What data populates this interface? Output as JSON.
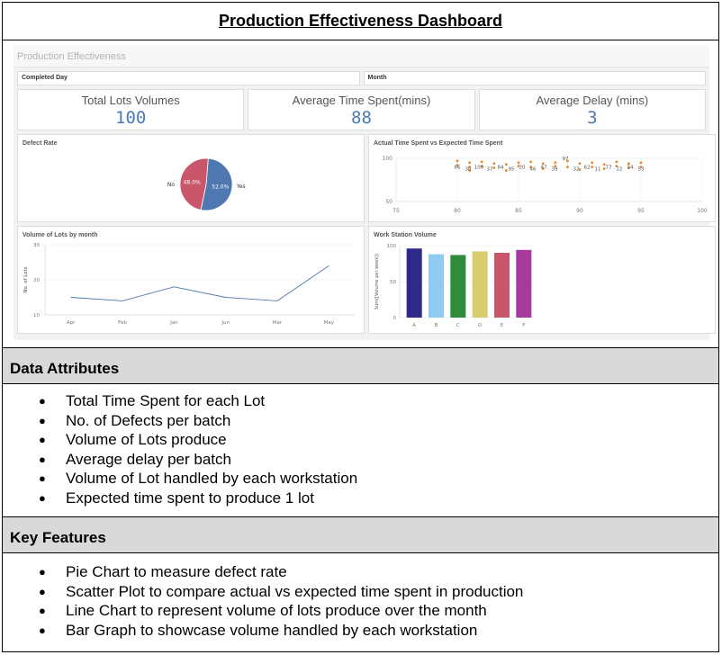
{
  "document": {
    "title": "Production Effectiveness Dashboard"
  },
  "dashboard": {
    "sheet_title": "Production Effectiveness",
    "filters": [
      "Completed Day",
      "Month"
    ],
    "kpis": [
      {
        "label": "Total Lots Volumes",
        "value": "100"
      },
      {
        "label": "Average Time Spent(mins)",
        "value": "88"
      },
      {
        "label": "Average Delay (mins)",
        "value": "3"
      }
    ],
    "panels": {
      "defect_rate": "Defect Rate",
      "scatter": "Actual Time Spent vs Expected Time Spent",
      "line": "Volume of Lots by month",
      "bar": "Work Station Volume"
    }
  },
  "chart_data": [
    {
      "type": "pie",
      "title": "Defect Rate",
      "categories": [
        "No",
        "Yes"
      ],
      "values": [
        48.0,
        52.0
      ],
      "data_labels": [
        "48.0%",
        "52.0%"
      ],
      "colors": [
        "#c9566a",
        "#4f78b0"
      ]
    },
    {
      "type": "scatter",
      "title": "Actual Time Spent vs Expected Time Spent",
      "xlim": [
        75,
        100
      ],
      "ylim": [
        50,
        100
      ],
      "x_ticks": [
        "75",
        "80",
        "85",
        "90",
        "95",
        "100"
      ],
      "y_ticks": [
        "100",
        "50"
      ],
      "x": [
        80,
        80,
        81,
        81,
        81,
        82,
        82,
        83,
        83,
        84,
        84,
        85,
        85,
        86,
        86,
        87,
        87,
        88,
        88,
        89,
        89,
        90,
        90,
        91,
        91,
        92,
        92,
        93,
        93,
        94,
        94,
        95,
        95
      ],
      "y": [
        97,
        92,
        95,
        90,
        86,
        96,
        91,
        94,
        89,
        93,
        86,
        95,
        91,
        96,
        90,
        94,
        88,
        95,
        91,
        97,
        90,
        94,
        87,
        95,
        90,
        93,
        88,
        96,
        91,
        94,
        89,
        95,
        90
      ],
      "point_labels": [
        "66",
        "30",
        "100",
        "37",
        "84",
        "95",
        "20",
        "46",
        "47",
        "39",
        "97",
        "32",
        "62",
        "11",
        "77",
        "22",
        "34",
        "53"
      ],
      "point_color": "#e8862b"
    },
    {
      "type": "line",
      "title": "Volume of Lots by month",
      "ylabel": "No. of Lots",
      "categories": [
        "Apr",
        "Feb",
        "Jan",
        "Jun",
        "Mar",
        "May"
      ],
      "values": [
        15,
        14,
        18,
        15,
        14,
        24
      ],
      "ylim": [
        10,
        30
      ],
      "y_ticks": [
        "30",
        "20",
        "10"
      ],
      "color": "#4f78b0"
    },
    {
      "type": "bar",
      "title": "Work Station Volume",
      "ylabel": "Sum([Volume per week])",
      "categories": [
        "A",
        "B",
        "C",
        "D",
        "E",
        "F"
      ],
      "values": [
        96,
        88,
        87,
        92,
        90,
        94
      ],
      "ylim": [
        0,
        100
      ],
      "y_ticks": [
        "100",
        "50",
        "0"
      ],
      "colors": [
        "#2e2a8a",
        "#8fcbf0",
        "#2f8c3c",
        "#d8cc6e",
        "#c9566a",
        "#a6399e"
      ]
    }
  ],
  "sections": [
    {
      "heading": "Data Attributes",
      "items": [
        "Total Time Spent for each Lot",
        "No. of Defects per batch",
        "Volume of Lots produce",
        "Average delay per batch",
        "Volume of Lot handled by each workstation",
        "Expected time spent to produce 1 lot"
      ]
    },
    {
      "heading": "Key Features",
      "items": [
        "Pie Chart to measure defect rate",
        "Scatter Plot to compare actual vs expected time spent in production",
        "Line Chart to represent volume of lots produce over the month",
        "Bar Graph to showcase volume handled by each workstation"
      ]
    }
  ]
}
